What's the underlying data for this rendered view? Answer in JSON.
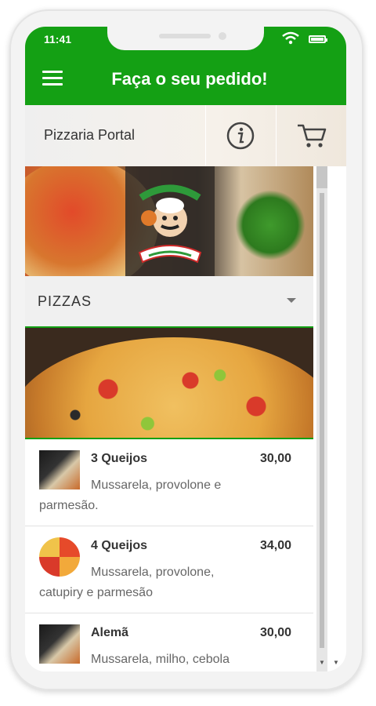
{
  "status": {
    "time": "11:41"
  },
  "appbar": {
    "title": "Faça o seu pedido!"
  },
  "store": {
    "name": "Pizzaria Portal"
  },
  "category": {
    "label": "PIZZAS"
  },
  "menu_items": [
    {
      "name": "3 Queijos",
      "price": "30,00",
      "description": "Mussarela, provolone e parmesão.",
      "thumb": "pizzeria-logo"
    },
    {
      "name": "4 Queijos",
      "price": "34,00",
      "description": "Mussarela, provolone, catupiry e parmesão",
      "thumb": "pizza-slices"
    },
    {
      "name": "Alemã",
      "price": "30,00",
      "description": "Mussarela, milho, cebola",
      "thumb": "pizzeria-logo"
    }
  ],
  "colors": {
    "brand_green": "#14a014"
  }
}
